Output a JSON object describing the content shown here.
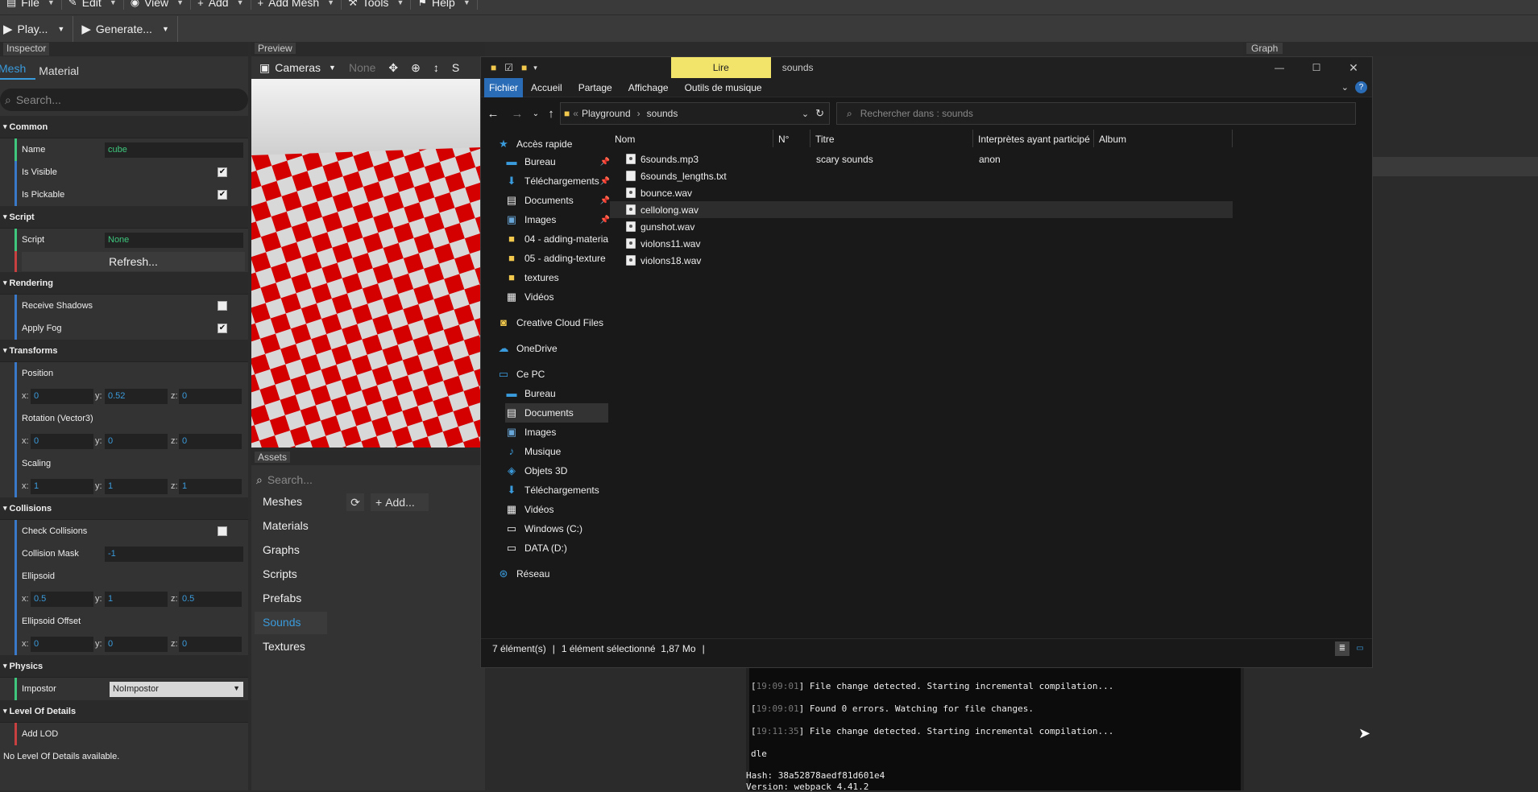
{
  "menubar": {
    "items": [
      {
        "label": "File",
        "icon": "file-icon"
      },
      {
        "label": "Edit",
        "icon": "edit-icon"
      },
      {
        "label": "View",
        "icon": "eye-icon"
      },
      {
        "label": "Add",
        "icon": "plus-icon"
      },
      {
        "label": "Add Mesh",
        "icon": "plus-icon"
      },
      {
        "label": "Tools",
        "icon": "wrench-icon"
      },
      {
        "label": "Help",
        "icon": "cart-icon"
      }
    ],
    "play_label": "Play...",
    "generate_label": "Generate..."
  },
  "inspector": {
    "title": "Inspector",
    "tabs": [
      "Mesh",
      "Material"
    ],
    "search_placeholder": "Search...",
    "common": {
      "title": "Common",
      "name_label": "Name",
      "name_value": "cube",
      "visible_label": "Is Visible",
      "visible": true,
      "pickable_label": "Is Pickable",
      "pickable": true
    },
    "script": {
      "title": "Script",
      "script_label": "Script",
      "script_value": "None",
      "refresh_label": "Refresh..."
    },
    "rendering": {
      "title": "Rendering",
      "shadows_label": "Receive Shadows",
      "shadows": false,
      "fog_label": "Apply Fog",
      "fog": true
    },
    "transforms": {
      "title": "Transforms",
      "position_label": "Position",
      "position": {
        "x": "0",
        "y": "0.52",
        "z": "0"
      },
      "rotation_label": "Rotation (Vector3)",
      "rotation": {
        "x": "0",
        "y": "0",
        "z": "0"
      },
      "scaling_label": "Scaling",
      "scaling": {
        "x": "1",
        "y": "1",
        "z": "1"
      }
    },
    "collisions": {
      "title": "Collisions",
      "check_label": "Check Collisions",
      "check": false,
      "mask_label": "Collision Mask",
      "mask_value": "-1",
      "ellipsoid_label": "Ellipsoid",
      "ellipsoid": {
        "x": "0.5",
        "y": "1",
        "z": "0.5"
      },
      "offset_label": "Ellipsoid Offset",
      "offset": {
        "x": "0",
        "y": "0",
        "z": "0"
      }
    },
    "physics": {
      "title": "Physics",
      "impostor_label": "Impostor",
      "impostor_value": "NoImpostor"
    },
    "lod": {
      "title": "Level Of Details",
      "add_label": "Add LOD",
      "empty_text": "No Level Of Details available."
    }
  },
  "preview": {
    "title": "Preview",
    "cameras_label": "Cameras",
    "none_label": "None",
    "s_label": "S"
  },
  "assets": {
    "title": "Assets",
    "search_placeholder": "Search...",
    "add_label": "Add...",
    "categories": [
      "Meshes",
      "Materials",
      "Graphs",
      "Scripts",
      "Prefabs",
      "Sounds",
      "Textures"
    ],
    "active_category": "Sounds"
  },
  "graph": {
    "title": "Graph"
  },
  "explorer": {
    "contextual_tab": "Lire",
    "window_title": "sounds",
    "ribbon": [
      "Fichier",
      "Accueil",
      "Partage",
      "Affichage",
      "Outils de musique"
    ],
    "breadcrumb": [
      "Playground",
      "sounds"
    ],
    "search_placeholder": "Rechercher dans : sounds",
    "nav": {
      "quick_access": "Accès rapide",
      "quick": [
        {
          "label": "Bureau",
          "pinned": true
        },
        {
          "label": "Téléchargements",
          "pinned": true
        },
        {
          "label": "Documents",
          "pinned": true
        },
        {
          "label": "Images",
          "pinned": true
        },
        {
          "label": "04 - adding-materia",
          "pinned": false
        },
        {
          "label": "05 - adding-texture",
          "pinned": false
        },
        {
          "label": "textures",
          "pinned": false
        },
        {
          "label": "Vidéos",
          "pinned": false
        }
      ],
      "creative_cloud": "Creative Cloud Files",
      "onedrive": "OneDrive",
      "this_pc": "Ce PC",
      "pc": [
        "Bureau",
        "Documents",
        "Images",
        "Musique",
        "Objets 3D",
        "Téléchargements",
        "Vidéos",
        "Windows (C:)",
        "DATA (D:)"
      ],
      "network": "Réseau"
    },
    "columns": [
      "Nom",
      "N°",
      "Titre",
      "Interprètes ayant participé",
      "Album"
    ],
    "files": [
      {
        "name": "6sounds.mp3",
        "title": "scary sounds",
        "artist": "anon",
        "type": "audio"
      },
      {
        "name": "6sounds_lengths.txt",
        "title": "",
        "artist": "",
        "type": "text"
      },
      {
        "name": "bounce.wav",
        "title": "",
        "artist": "",
        "type": "audio"
      },
      {
        "name": "cellolong.wav",
        "title": "",
        "artist": "",
        "type": "audio"
      },
      {
        "name": "gunshot.wav",
        "title": "",
        "artist": "",
        "type": "audio"
      },
      {
        "name": "violons11.wav",
        "title": "",
        "artist": "",
        "type": "audio"
      },
      {
        "name": "violons18.wav",
        "title": "",
        "artist": "",
        "type": "audio"
      }
    ],
    "selected_file": "cellolong.wav",
    "status": {
      "count": "7 élément(s)",
      "selection": "1 élément sélectionné  1,87 Mo"
    }
  },
  "terminal": {
    "lines": [
      {
        "time": "19:09:01",
        "text": "] File change detected. Starting incremental compilation..."
      },
      {
        "time": "19:09:01",
        "text": "] Found 0 errors. Watching for file changes."
      },
      {
        "time": "19:11:35",
        "text": "] File change detected. Starting incremental compilation..."
      }
    ],
    "idle": "dle",
    "hash": "Hash: 38a52878aedf81d601e4",
    "version": "Version: webpack 4.41.2"
  },
  "colors": {
    "accent": "#3a9bdc",
    "checker_red": "#d40000",
    "explorer_bg": "#191919",
    "ribbon_active": "#2b6cb7",
    "contextual_tab": "#f2e46b"
  }
}
